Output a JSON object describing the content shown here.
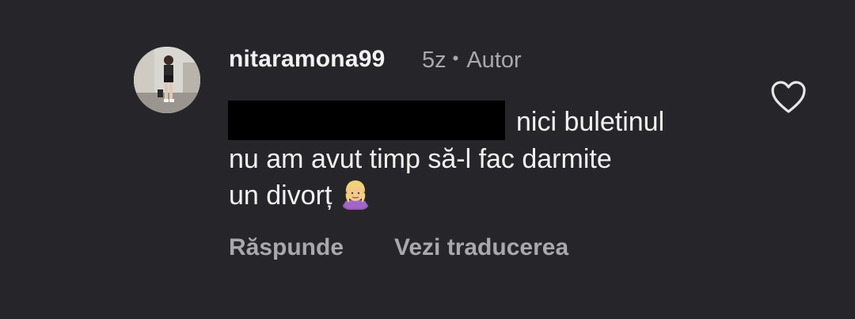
{
  "comment": {
    "username": "nitaramona99",
    "time": "5z",
    "separator": "•",
    "author_badge": "Autor",
    "text_line1": "nici buletinul",
    "text_line2": "nu am avut timp să-l fac darmite",
    "text_line3": "un divorț",
    "emoji": "woman-shrugging-emoji",
    "redacted": true
  },
  "actions": {
    "reply_label": "Răspunde",
    "translate_label": "Vezi traducerea"
  },
  "icons": {
    "like": "heart-outline-icon"
  },
  "colors": {
    "background": "#26262a",
    "primary_text": "#f2f2f2",
    "secondary_text": "#a8a8ad",
    "redaction": "#000000"
  }
}
